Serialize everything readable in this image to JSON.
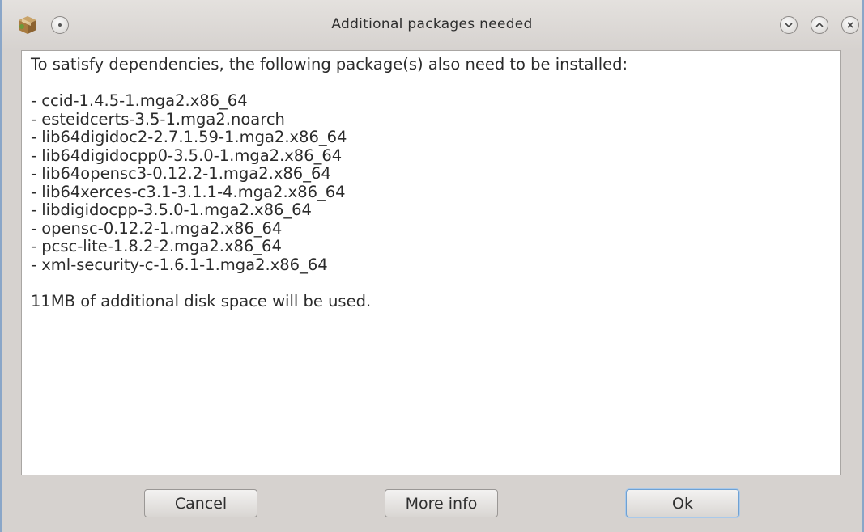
{
  "window": {
    "title": "Additional packages needed"
  },
  "icons": {
    "app": "package-icon",
    "menu": "window-menu-icon",
    "minimize": "chevron-down-icon",
    "maximize": "chevron-up-icon",
    "close": "close-icon"
  },
  "message": {
    "intro": "To satisfy dependencies, the following package(s) also need to be installed:",
    "packages": [
      "- ccid-1.4.5-1.mga2.x86_64",
      "- esteidcerts-3.5-1.mga2.noarch",
      "- lib64digidoc2-2.7.1.59-1.mga2.x86_64",
      "- lib64digidocpp0-3.5.0-1.mga2.x86_64",
      "- lib64opensc3-0.12.2-1.mga2.x86_64",
      "- lib64xerces-c3.1-3.1.1-4.mga2.x86_64",
      "- libdigidocpp-3.5.0-1.mga2.x86_64",
      "- opensc-0.12.2-1.mga2.x86_64",
      "- pcsc-lite-1.8.2-2.mga2.x86_64",
      "- xml-security-c-1.6.1-1.mga2.x86_64"
    ],
    "summary": "11MB of additional disk space will be used."
  },
  "buttons": {
    "cancel": "Cancel",
    "more_info": "More info",
    "ok": "Ok"
  },
  "colors": {
    "accent_border": "#8aa6c8",
    "focus_ring": "#6fa1d3"
  }
}
